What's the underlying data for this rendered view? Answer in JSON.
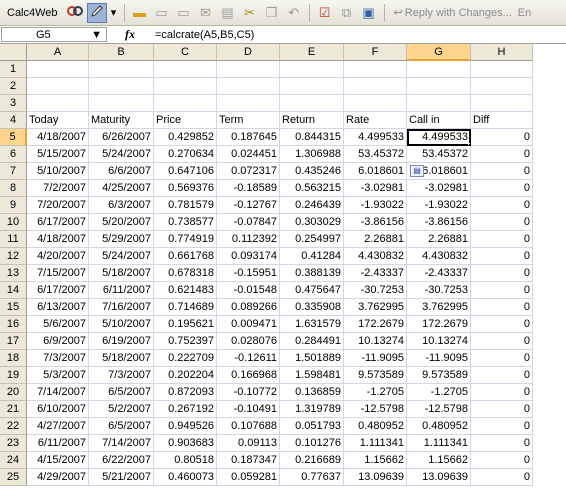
{
  "toolbar": {
    "app_label": "Calc4Web",
    "reply_label": "Reply with Changes...",
    "trailing_label": "En"
  },
  "formula_bar": {
    "name_box": "G5",
    "fx_label": "fx",
    "formula": "=calcrate(A5,B5,C5)"
  },
  "columns": [
    "A",
    "B",
    "C",
    "D",
    "E",
    "F",
    "G",
    "H"
  ],
  "row_numbers": [
    1,
    2,
    3,
    4,
    5,
    6,
    7,
    8,
    9,
    10,
    11,
    12,
    13,
    14,
    15,
    16,
    17,
    18,
    19,
    20,
    21,
    22,
    23,
    24,
    25
  ],
  "headers": [
    "Today",
    "Maturity",
    "Price",
    "Term",
    "Return",
    "Rate",
    "Call in",
    "Diff"
  ],
  "rows": [
    [
      "4/18/2007",
      "6/26/2007",
      "0.429852",
      "0.187645",
      "0.844315",
      "4.499533",
      "4.499533",
      "0"
    ],
    [
      "5/15/2007",
      "5/24/2007",
      "0.270634",
      "0.024451",
      "1.306988",
      "53.45372",
      "53.45372",
      "0"
    ],
    [
      "5/10/2007",
      "6/6/2007",
      "0.647106",
      "0.072317",
      "0.435246",
      "6.018601",
      "6.018601",
      "0"
    ],
    [
      "7/2/2007",
      "4/25/2007",
      "0.569376",
      "-0.18589",
      "0.563215",
      "-3.02981",
      "-3.02981",
      "0"
    ],
    [
      "7/20/2007",
      "6/3/2007",
      "0.781579",
      "-0.12767",
      "0.246439",
      "-1.93022",
      "-1.93022",
      "0"
    ],
    [
      "6/17/2007",
      "5/20/2007",
      "0.738577",
      "-0.07847",
      "0.303029",
      "-3.86156",
      "-3.86156",
      "0"
    ],
    [
      "4/18/2007",
      "5/29/2007",
      "0.774919",
      "0.112392",
      "0.254997",
      "2.26881",
      "2.26881",
      "0"
    ],
    [
      "4/20/2007",
      "5/24/2007",
      "0.661768",
      "0.093174",
      "0.41284",
      "4.430832",
      "4.430832",
      "0"
    ],
    [
      "7/15/2007",
      "5/18/2007",
      "0.678318",
      "-0.15951",
      "0.388139",
      "-2.43337",
      "-2.43337",
      "0"
    ],
    [
      "6/17/2007",
      "6/11/2007",
      "0.621483",
      "-0.01548",
      "0.475647",
      "-30.7253",
      "-30.7253",
      "0"
    ],
    [
      "6/13/2007",
      "7/16/2007",
      "0.714689",
      "0.089266",
      "0.335908",
      "3.762995",
      "3.762995",
      "0"
    ],
    [
      "5/6/2007",
      "5/10/2007",
      "0.195621",
      "0.009471",
      "1.631579",
      "172.2679",
      "172.2679",
      "0"
    ],
    [
      "6/9/2007",
      "6/19/2007",
      "0.752397",
      "0.028076",
      "0.284491",
      "10.13274",
      "10.13274",
      "0"
    ],
    [
      "7/3/2007",
      "5/18/2007",
      "0.222709",
      "-0.12611",
      "1.501889",
      "-11.9095",
      "-11.9095",
      "0"
    ],
    [
      "5/3/2007",
      "7/3/2007",
      "0.202204",
      "0.166968",
      "1.598481",
      "9.573589",
      "9.573589",
      "0"
    ],
    [
      "7/14/2007",
      "6/5/2007",
      "0.872093",
      "-0.10772",
      "0.136859",
      "-1.2705",
      "-1.2705",
      "0"
    ],
    [
      "6/10/2007",
      "5/2/2007",
      "0.267192",
      "-0.10491",
      "1.319789",
      "-12.5798",
      "-12.5798",
      "0"
    ],
    [
      "4/27/2007",
      "6/5/2007",
      "0.949526",
      "0.107688",
      "0.051793",
      "0.480952",
      "0.480952",
      "0"
    ],
    [
      "6/11/2007",
      "7/14/2007",
      "0.903683",
      "0.09113",
      "0.101276",
      "1.111341",
      "1.111341",
      "0"
    ],
    [
      "4/15/2007",
      "6/22/2007",
      "0.80518",
      "0.187347",
      "0.216689",
      "1.15662",
      "1.15662",
      "0"
    ],
    [
      "4/29/2007",
      "5/21/2007",
      "0.460073",
      "0.059281",
      "0.77637",
      "13.09639",
      "13.09639",
      "0"
    ]
  ],
  "icons": {
    "link_icon": "chain-link-icon",
    "edit_icon": "pencil-icon",
    "dropdown_icon": "chevron-down-icon"
  }
}
